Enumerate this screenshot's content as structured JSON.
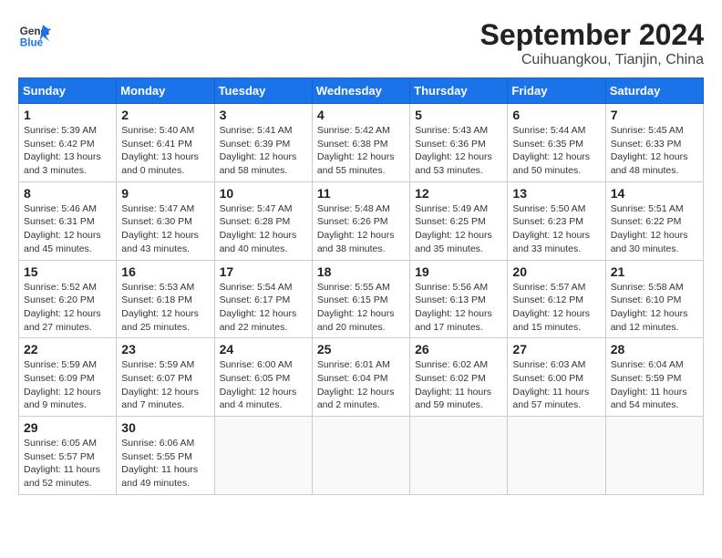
{
  "header": {
    "logo_general": "General",
    "logo_blue": "Blue",
    "month_year": "September 2024",
    "location": "Cuihuangkou, Tianjin, China"
  },
  "columns": [
    "Sunday",
    "Monday",
    "Tuesday",
    "Wednesday",
    "Thursday",
    "Friday",
    "Saturday"
  ],
  "weeks": [
    [
      {
        "day": "1",
        "info": "Sunrise: 5:39 AM\nSunset: 6:42 PM\nDaylight: 13 hours\nand 3 minutes."
      },
      {
        "day": "2",
        "info": "Sunrise: 5:40 AM\nSunset: 6:41 PM\nDaylight: 13 hours\nand 0 minutes."
      },
      {
        "day": "3",
        "info": "Sunrise: 5:41 AM\nSunset: 6:39 PM\nDaylight: 12 hours\nand 58 minutes."
      },
      {
        "day": "4",
        "info": "Sunrise: 5:42 AM\nSunset: 6:38 PM\nDaylight: 12 hours\nand 55 minutes."
      },
      {
        "day": "5",
        "info": "Sunrise: 5:43 AM\nSunset: 6:36 PM\nDaylight: 12 hours\nand 53 minutes."
      },
      {
        "day": "6",
        "info": "Sunrise: 5:44 AM\nSunset: 6:35 PM\nDaylight: 12 hours\nand 50 minutes."
      },
      {
        "day": "7",
        "info": "Sunrise: 5:45 AM\nSunset: 6:33 PM\nDaylight: 12 hours\nand 48 minutes."
      }
    ],
    [
      {
        "day": "8",
        "info": "Sunrise: 5:46 AM\nSunset: 6:31 PM\nDaylight: 12 hours\nand 45 minutes."
      },
      {
        "day": "9",
        "info": "Sunrise: 5:47 AM\nSunset: 6:30 PM\nDaylight: 12 hours\nand 43 minutes."
      },
      {
        "day": "10",
        "info": "Sunrise: 5:47 AM\nSunset: 6:28 PM\nDaylight: 12 hours\nand 40 minutes."
      },
      {
        "day": "11",
        "info": "Sunrise: 5:48 AM\nSunset: 6:26 PM\nDaylight: 12 hours\nand 38 minutes."
      },
      {
        "day": "12",
        "info": "Sunrise: 5:49 AM\nSunset: 6:25 PM\nDaylight: 12 hours\nand 35 minutes."
      },
      {
        "day": "13",
        "info": "Sunrise: 5:50 AM\nSunset: 6:23 PM\nDaylight: 12 hours\nand 33 minutes."
      },
      {
        "day": "14",
        "info": "Sunrise: 5:51 AM\nSunset: 6:22 PM\nDaylight: 12 hours\nand 30 minutes."
      }
    ],
    [
      {
        "day": "15",
        "info": "Sunrise: 5:52 AM\nSunset: 6:20 PM\nDaylight: 12 hours\nand 27 minutes."
      },
      {
        "day": "16",
        "info": "Sunrise: 5:53 AM\nSunset: 6:18 PM\nDaylight: 12 hours\nand 25 minutes."
      },
      {
        "day": "17",
        "info": "Sunrise: 5:54 AM\nSunset: 6:17 PM\nDaylight: 12 hours\nand 22 minutes."
      },
      {
        "day": "18",
        "info": "Sunrise: 5:55 AM\nSunset: 6:15 PM\nDaylight: 12 hours\nand 20 minutes."
      },
      {
        "day": "19",
        "info": "Sunrise: 5:56 AM\nSunset: 6:13 PM\nDaylight: 12 hours\nand 17 minutes."
      },
      {
        "day": "20",
        "info": "Sunrise: 5:57 AM\nSunset: 6:12 PM\nDaylight: 12 hours\nand 15 minutes."
      },
      {
        "day": "21",
        "info": "Sunrise: 5:58 AM\nSunset: 6:10 PM\nDaylight: 12 hours\nand 12 minutes."
      }
    ],
    [
      {
        "day": "22",
        "info": "Sunrise: 5:59 AM\nSunset: 6:09 PM\nDaylight: 12 hours\nand 9 minutes."
      },
      {
        "day": "23",
        "info": "Sunrise: 5:59 AM\nSunset: 6:07 PM\nDaylight: 12 hours\nand 7 minutes."
      },
      {
        "day": "24",
        "info": "Sunrise: 6:00 AM\nSunset: 6:05 PM\nDaylight: 12 hours\nand 4 minutes."
      },
      {
        "day": "25",
        "info": "Sunrise: 6:01 AM\nSunset: 6:04 PM\nDaylight: 12 hours\nand 2 minutes."
      },
      {
        "day": "26",
        "info": "Sunrise: 6:02 AM\nSunset: 6:02 PM\nDaylight: 11 hours\nand 59 minutes."
      },
      {
        "day": "27",
        "info": "Sunrise: 6:03 AM\nSunset: 6:00 PM\nDaylight: 11 hours\nand 57 minutes."
      },
      {
        "day": "28",
        "info": "Sunrise: 6:04 AM\nSunset: 5:59 PM\nDaylight: 11 hours\nand 54 minutes."
      }
    ],
    [
      {
        "day": "29",
        "info": "Sunrise: 6:05 AM\nSunset: 5:57 PM\nDaylight: 11 hours\nand 52 minutes."
      },
      {
        "day": "30",
        "info": "Sunrise: 6:06 AM\nSunset: 5:55 PM\nDaylight: 11 hours\nand 49 minutes."
      },
      null,
      null,
      null,
      null,
      null
    ]
  ]
}
